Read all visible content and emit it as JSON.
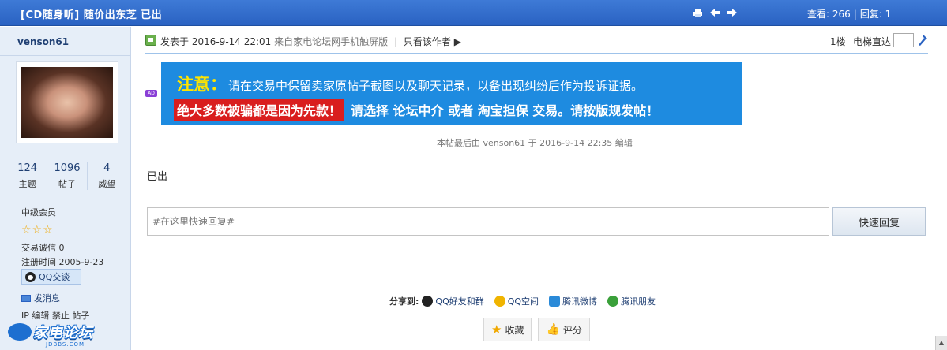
{
  "header": {
    "thread_title": "[CD随身听] 随价出东芝 已出",
    "tool_icons": [
      "print-icon",
      "prev-icon",
      "next-icon"
    ],
    "views_label": "查看: 266",
    "separator": "|",
    "replies_label": "回复: 1"
  },
  "user": {
    "name": "venson61",
    "stats": [
      {
        "value": "124",
        "label": "主题"
      },
      {
        "value": "1096",
        "label": "帖子"
      },
      {
        "value": "4",
        "label": "威望"
      }
    ],
    "rank": "中级会员",
    "stars": "☆☆☆",
    "trade_credit": "交易诚信  0",
    "reg_date": "注册时间  2005-9-23",
    "qq_button": "QQ交谈",
    "send_msg": "发消息",
    "admin_links": "IP 编辑 禁止 帖子"
  },
  "logo": {
    "brand": "家电论坛",
    "sub": "JDBBS.COM"
  },
  "post": {
    "posted_at": "发表于 2016-9-14 22:01",
    "source": "来自家电论坛网手机触屏版",
    "separator": "|",
    "only_author": "只看该作者 ▶",
    "floor": "1楼",
    "elevator": "电梯直达",
    "ad_tag": "AD",
    "edited_note": "本帖最后由 venson61 于 2016-9-14 22:35 编辑",
    "body": "已出"
  },
  "banner": {
    "attention": "注意：",
    "line1": "请在交易中保留卖家原帖子截图以及聊天记录，以备出现纠纷后作为投诉证据。",
    "warning": "绝大多数被骗都是因为先款！",
    "line2": "请选择 论坛中介 或者 淘宝担保 交易。请按版规发帖！"
  },
  "reply": {
    "placeholder": "#在这里快速回复#",
    "button": "快速回复"
  },
  "share": {
    "label": "分享到:",
    "items": [
      "QQ好友和群",
      "QQ空间",
      "腾讯微博",
      "腾讯朋友"
    ]
  },
  "actions": {
    "favorite": "收藏",
    "rate": "评分"
  },
  "colors": {
    "header_bg": "#2a62c2",
    "sidebar_bg": "#e6eef8",
    "banner_bg": "#1e8be0",
    "banner_warning": "#d91e1e",
    "banner_attention": "#ffe400"
  }
}
